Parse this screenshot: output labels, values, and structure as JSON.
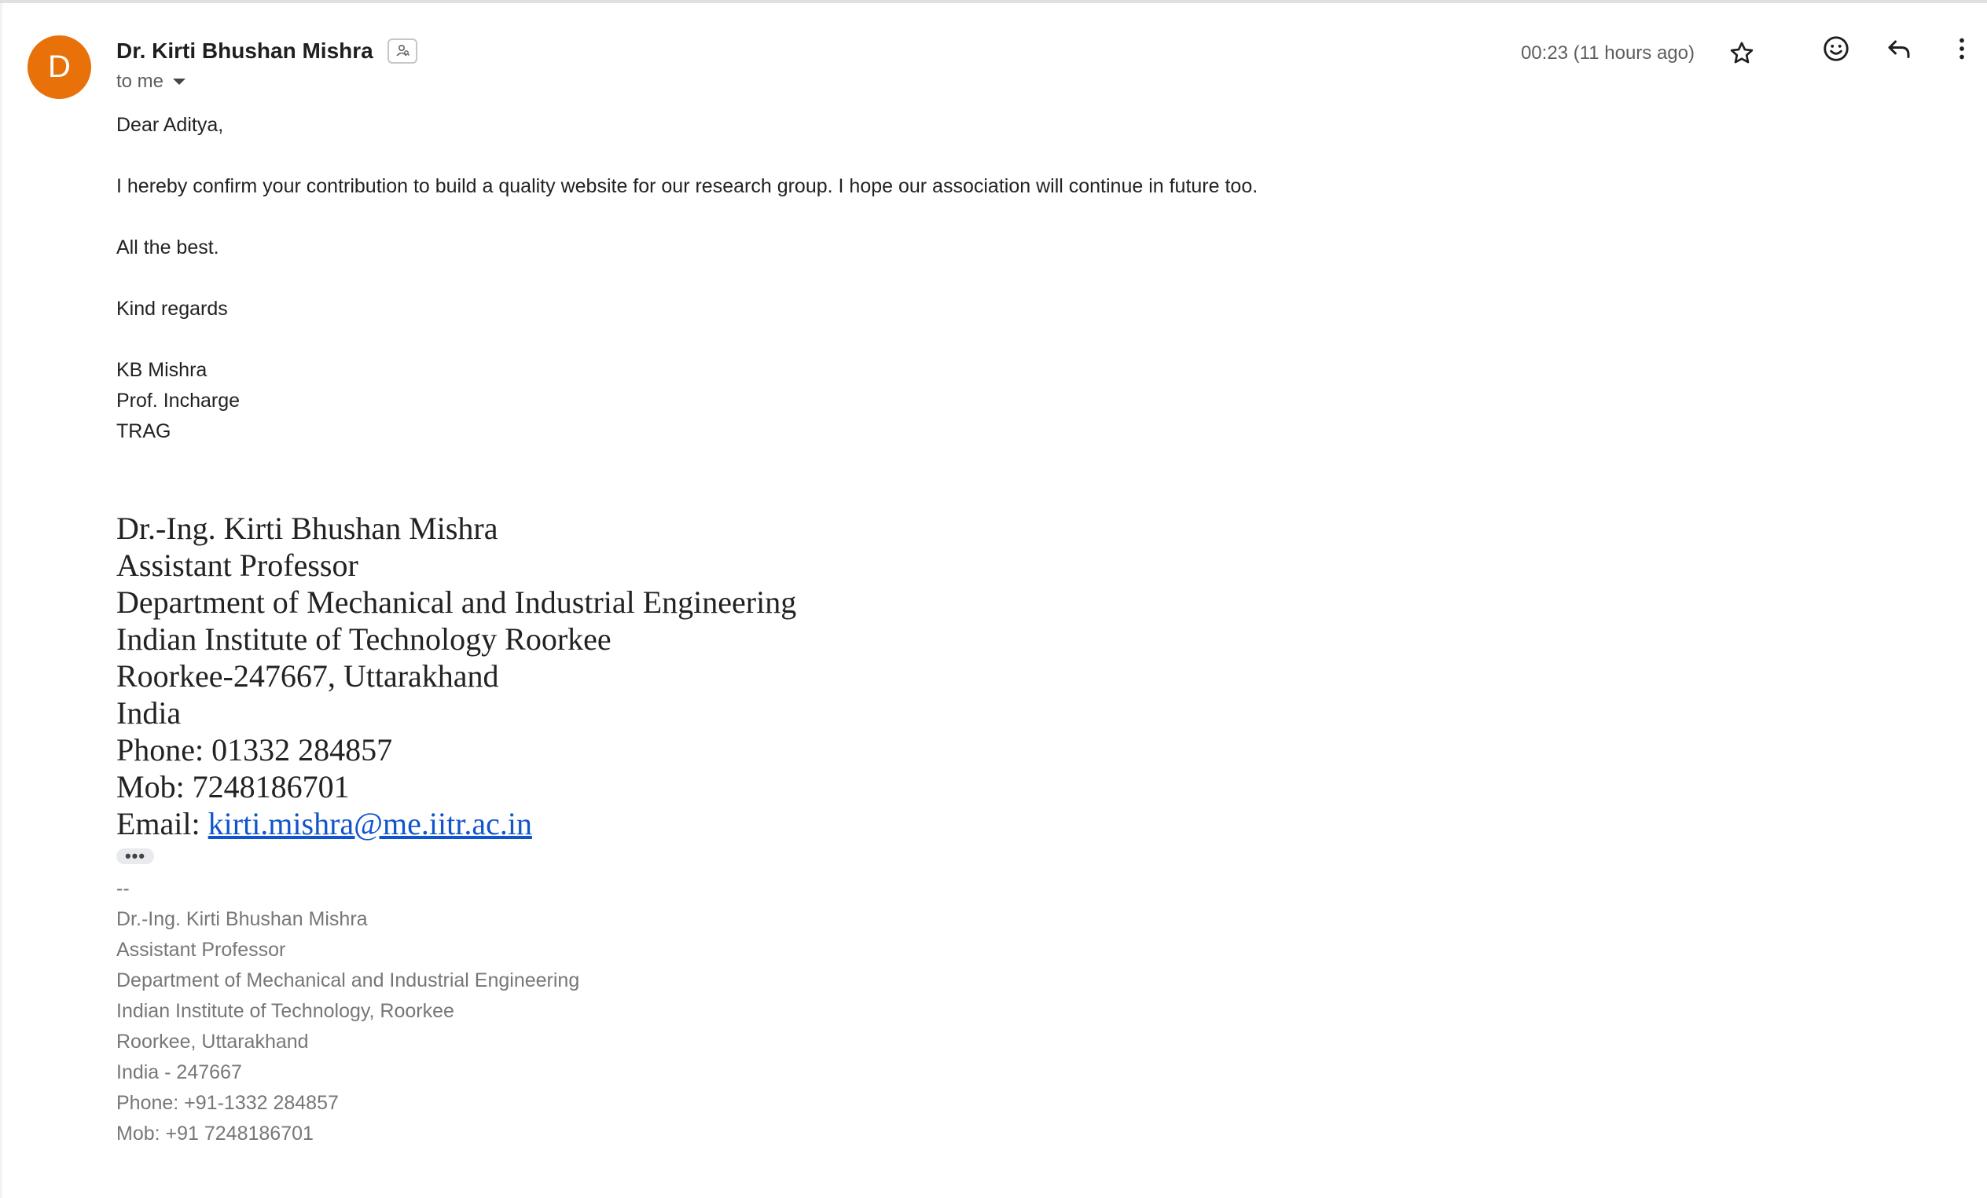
{
  "message": {
    "avatar_letter": "D",
    "avatar_color": "#e8710a",
    "sender_name": "Dr. Kirti Bhushan Mishra",
    "recipient_label": "to me",
    "timestamp": "00:23 (11 hours ago)"
  },
  "icons": {
    "contact": "contact-card-icon",
    "star": "star-outline-icon",
    "emoji": "emoji-reaction-icon",
    "reply": "reply-icon",
    "more": "more-vertical-icon",
    "caret": "caret-down-icon"
  },
  "body": {
    "greeting": "Dear Aditya,",
    "paragraph": "I hereby confirm your contribution to build a quality website for our research group. I hope our association will continue in future too.",
    "wish": "All the best.",
    "closing": "Kind regards",
    "sign_name": "KB Mishra",
    "sign_role": "Prof. Incharge",
    "sign_group": "TRAG"
  },
  "signature": {
    "name": "Dr.-Ing. Kirti Bhushan Mishra",
    "title": "Assistant Professor",
    "department": "Department of Mechanical and Industrial Engineering",
    "institute": "Indian Institute of Technology Roorkee",
    "city": "Roorkee-247667, Uttarakhand",
    "country": "India",
    "phone": "Phone: 01332 284857",
    "mobile": "Mob: 7248186701",
    "email_label": "Email: ",
    "email_link": "kirti.mishra@me.iitr.ac.in",
    "link_color": "#1155cc"
  },
  "trimmed_toggle": "•••",
  "quoted_signature": {
    "separator": "--",
    "lines": [
      "Dr.-Ing. Kirti Bhushan Mishra",
      "Assistant Professor",
      "Department of Mechanical and Industrial Engineering",
      "Indian Institute of Technology, Roorkee",
      "Roorkee, Uttarakhand",
      "India - 247667",
      "Phone: +91-1332 284857",
      "Mob: +91 7248186701"
    ]
  }
}
